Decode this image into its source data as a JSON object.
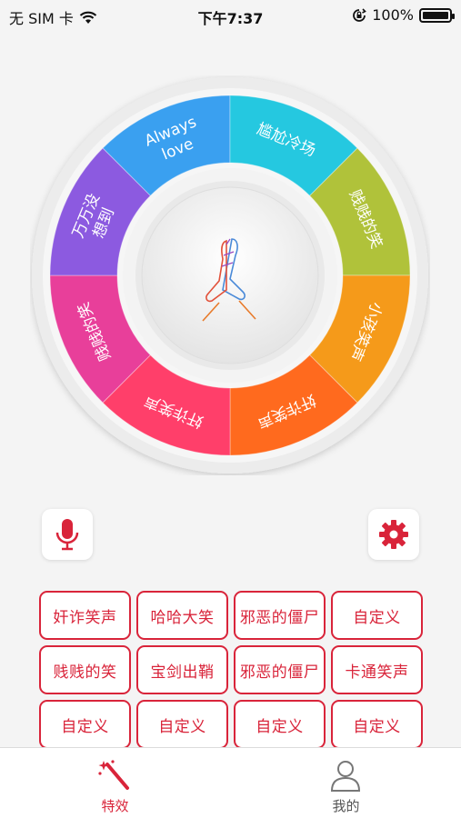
{
  "status_bar": {
    "carrier": "无 SIM 卡",
    "time": "下午7:37",
    "battery": "100%",
    "icons": [
      "wifi-icon",
      "orientation-lock-icon",
      "battery-icon"
    ]
  },
  "wheel": {
    "segments": [
      {
        "line1": "Always",
        "line2": "love"
      },
      {
        "line1": "尴尬冷场",
        "line2": ""
      },
      {
        "line1": "贱贱的笑",
        "line2": ""
      },
      {
        "line1": "小孩笑声",
        "line2": ""
      },
      {
        "line1": "奸诈笑声",
        "line2": ""
      },
      {
        "line1": "奸诈笑声",
        "line2": ""
      },
      {
        "line1": "贱贱的笑",
        "line2": ""
      },
      {
        "line1": "万万没",
        "line2": "想到"
      }
    ],
    "center_icon": "praying-hands-icon"
  },
  "controls": {
    "mic_icon": "microphone-icon",
    "settings_icon": "gear-icon"
  },
  "sounds": [
    "奸诈笑声",
    "哈哈大笑",
    "邪恶的僵尸",
    "自定义",
    "贱贱的笑",
    "宝剑出鞘",
    "邪恶的僵尸",
    "卡通笑声",
    "自定义",
    "自定义",
    "自定义",
    "自定义"
  ],
  "tabs": [
    {
      "label": "特效",
      "icon": "magic-wand-icon",
      "active": true
    },
    {
      "label": "我的",
      "icon": "user-icon",
      "active": false
    }
  ],
  "colors": {
    "accent": "#d9243a",
    "segment_gradient": [
      "#3aa0f0",
      "#25c8e0",
      "#b0c23a",
      "#f59a1a",
      "#ff6a1e",
      "#ff3f6a",
      "#e83f9a",
      "#8c5ae0"
    ]
  }
}
